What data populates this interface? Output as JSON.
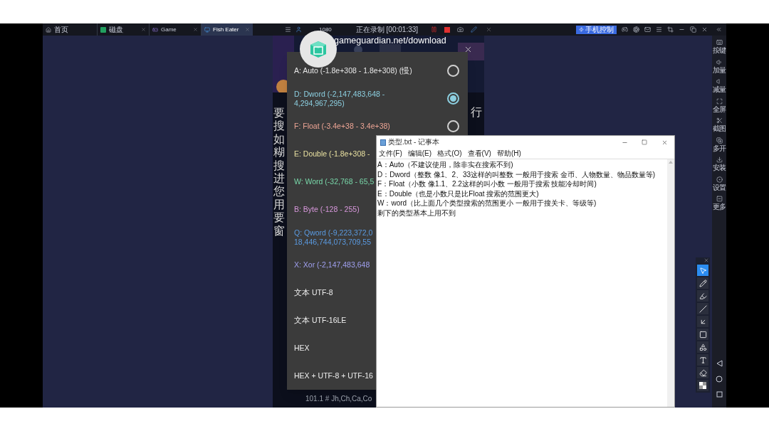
{
  "emulator": {
    "tabs": [
      {
        "label": "首页",
        "selected": false,
        "closable": false
      },
      {
        "label": "磁盘",
        "selected": false,
        "closable": true
      },
      {
        "label": "Game",
        "selected": false,
        "closable": true
      },
      {
        "label": "Fish Eater",
        "selected": true,
        "closable": true
      }
    ],
    "resolution": "1080",
    "recording": "正在录制 [00:01:33]",
    "phone_control": "手机控制",
    "sidebar": [
      {
        "kind": "keys",
        "label": "按键"
      },
      {
        "kind": "volume_up",
        "label": "加量"
      },
      {
        "kind": "volume_down",
        "label": "减量"
      },
      {
        "kind": "fullscreen",
        "label": "全屏"
      },
      {
        "kind": "screenshot",
        "label": "截图"
      },
      {
        "kind": "multi",
        "label": "多开"
      },
      {
        "kind": "install",
        "label": "安装"
      },
      {
        "kind": "settings",
        "label": "设置"
      },
      {
        "kind": "more",
        "label": "更多"
      }
    ]
  },
  "game": {
    "url": "gameguardian.net/download",
    "side_text": "要搜如糊搜进您用要窗",
    "right_text": "行",
    "bottom_text": "101.1 # Jh,Ch,Ca,Co"
  },
  "type_dialog": {
    "options": [
      {
        "label": "A: Auto (-1.8e+308 - 1.8e+308) (慢)",
        "color": "#e6e6e6",
        "selected": false
      },
      {
        "label": "D: Dword (-2,147,483,648 -\n4,294,967,295)",
        "color": "#8ccfe0",
        "selected": true
      },
      {
        "label": "F: Float (-3.4e+38 - 3.4e+38)",
        "color": "#eea595",
        "selected": false
      },
      {
        "label": "E: Double (-1.8e+308 -",
        "color": "#e8e0a0"
      },
      {
        "label": "W: Word (-32,768 - 65,5",
        "color": "#78d6a8"
      },
      {
        "label": "B: Byte (-128 - 255)",
        "color": "#d898dc"
      },
      {
        "label": "Q: Qword (-9,223,372,0\n18,446,744,073,709,55",
        "color": "#5a9ae0"
      },
      {
        "label": "X: Xor (-2,147,483,648",
        "color": "#a0a0f0"
      },
      {
        "label": "文本 UTF-8",
        "color": "#f0f0f0"
      },
      {
        "label": "文本 UTF-16LE",
        "color": "#f0f0f0"
      },
      {
        "label": "HEX",
        "color": "#f0f0f0"
      },
      {
        "label": "HEX + UTF-8 + UTF-16",
        "color": "#f0f0f0"
      }
    ]
  },
  "notepad": {
    "title": "类型.txt - 记事本",
    "menu": [
      "文件(F)",
      "编辑(E)",
      "格式(O)",
      "查看(V)",
      "帮助(H)"
    ],
    "lines": [
      "A：Auto（不建议使用，除非实在搜索不到)",
      "D：Dword（整数  像1、2、33这样的叫整数  一般用于搜索 金币、人物数量、物品数量等)",
      "F：Float（小数  像1.1、2.2这样的叫小数  一般用于搜索 技能冷却时间)",
      "E：Double（也是小数只是比Float 搜索的范围更大)",
      "W：word（比上面几个类型搜索的范围更小  一般用于搜关卡、等级等)",
      "剩下的类型基本上用不到"
    ]
  },
  "drawing_tools": [
    {
      "kind": "cursor",
      "selected": true
    },
    {
      "kind": "pencil",
      "selected": false
    },
    {
      "kind": "marker",
      "selected": false
    },
    {
      "kind": "line",
      "selected": false
    },
    {
      "kind": "arrow",
      "selected": false
    },
    {
      "kind": "rectangle",
      "selected": false
    },
    {
      "kind": "shapes",
      "selected": false
    },
    {
      "kind": "text",
      "selected": false
    },
    {
      "kind": "eraser",
      "selected": false
    },
    {
      "kind": "mosaic",
      "selected": false
    }
  ]
}
